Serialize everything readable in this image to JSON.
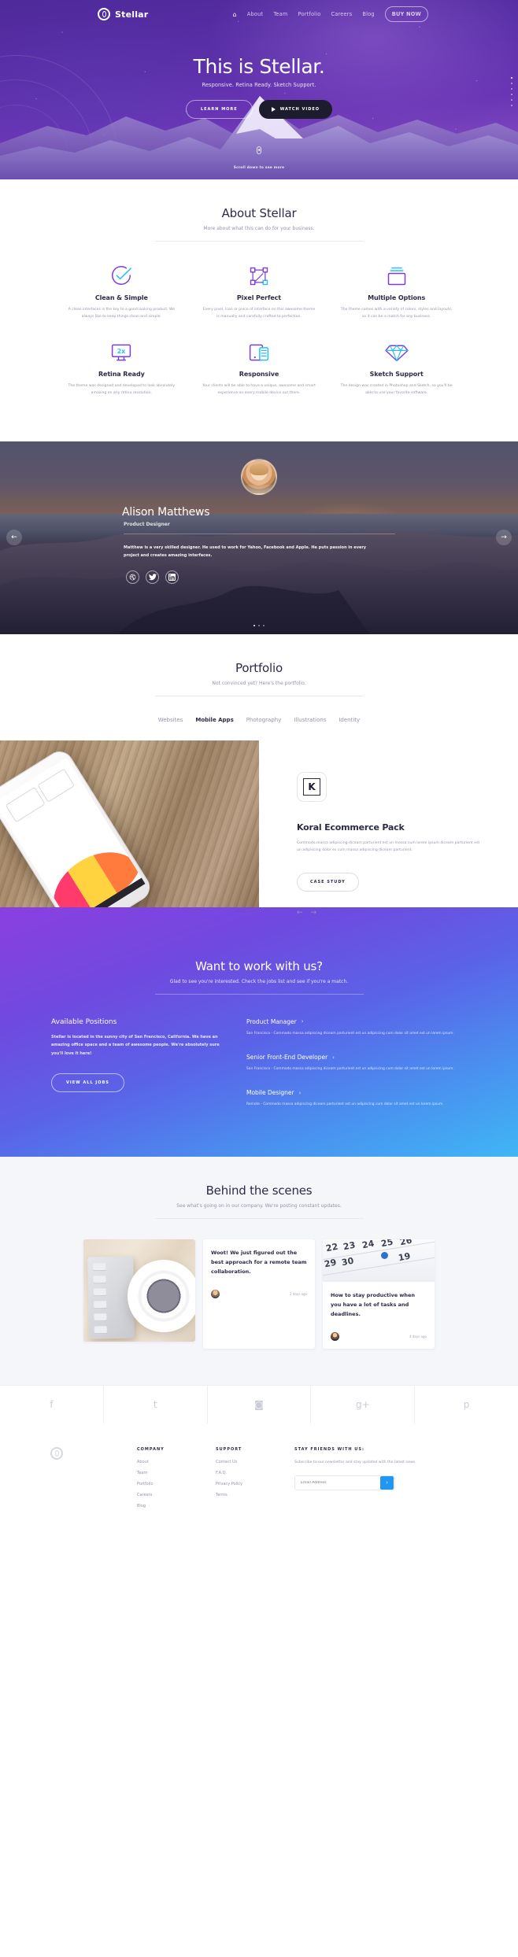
{
  "nav": {
    "brand": "Stellar",
    "brand_icon": "stellar-ring-logo",
    "items": [
      {
        "label": "⌂",
        "name": "home",
        "active": true
      },
      {
        "label": "About",
        "name": "about",
        "active": false
      },
      {
        "label": "Team",
        "name": "team",
        "active": false
      },
      {
        "label": "Portfolio",
        "name": "portfolio",
        "active": false
      },
      {
        "label": "Careers",
        "name": "careers",
        "active": false
      },
      {
        "label": "Blog",
        "name": "blog",
        "active": false
      }
    ],
    "buy_now": "BUY NOW"
  },
  "hero": {
    "title": "This is Stellar.",
    "subtitle": "Responsive. Retina Ready. Sketch Support.",
    "btn_primary": "LEARN MORE",
    "btn_secondary": "WATCH VIDEO",
    "scroll_hint": "Scroll down to see more"
  },
  "about": {
    "title": "About Stellar",
    "subtitle": "More about what this can do for your business.",
    "features": [
      {
        "icon": "check-circle-icon",
        "title": "Clean & Simple",
        "desc": "A clean interfaces is the key to a good looking product. We always like to keep things clean and simple."
      },
      {
        "icon": "vector-nodes-icon",
        "title": "Pixel Perfect",
        "desc": "Every pixel, icon or piece of interface on this awesome theme is manually and carefully crafted to perfection."
      },
      {
        "icon": "layers-stack-icon",
        "title": "Multiple Options",
        "desc": "The theme comes with a variety of colors, styles and layouts, so it can be a match for any business."
      },
      {
        "icon": "retina-monitor-icon",
        "title": "Retina Ready",
        "desc": "The theme was designed and developed to look absolutely amazing on any retina resolution."
      },
      {
        "icon": "devices-responsive-icon",
        "title": "Responsive",
        "desc": "Your clients will be able to have a unique, awesome and smart experience on every mobile device out there."
      },
      {
        "icon": "diamond-sketch-icon",
        "title": "Sketch Support",
        "desc": "The design was created in Photoshop and Sketch, so you'll be able to use your favorite software."
      }
    ]
  },
  "testimonial": {
    "avatar": "alison-avatar",
    "name": "Alison Matthews",
    "role": "Product Designer",
    "quote": "Matthew is a very skilled designer. He used to work for Yahoo, Facebook and Apple. He puts passion in every project and creates amazing interfaces.",
    "socials": [
      "dribbble-icon",
      "twitter-icon",
      "linkedin-icon"
    ],
    "prev": "←",
    "next": "→",
    "dots": 3,
    "active_dot": 0
  },
  "portfolio": {
    "title": "Portfolio",
    "subtitle": "Not convinced yet? Here's the portfolio.",
    "tabs": [
      {
        "label": "Websites",
        "active": false
      },
      {
        "label": "Mobile Apps",
        "active": true
      },
      {
        "label": "Photography",
        "active": false
      },
      {
        "label": "Illustrations",
        "active": false
      },
      {
        "label": "Identity",
        "active": false
      }
    ],
    "item": {
      "logo_letter": "K",
      "title": "Koral Ecommerce Pack",
      "desc": "Commodo massa adipiscing diceam parturient est un massa cum lorem ipsum diceam parturient est un adipiscing dolor es cum massa adipiscing diceam parturient.",
      "cta": "CASE STUDY",
      "prev": "←",
      "next": "→"
    }
  },
  "careers": {
    "title": "Want to work with us?",
    "subtitle": "Glad to see you're interested. Check the jobs list and see if you're a match.",
    "left_heading": "Available Positions",
    "left_desc": "Stellar is located in the sunny city of San Francisco, California. We have an amazing office space and a team of awesome people. We're absolutely sure you'll love it here!",
    "left_cta": "VIEW ALL JOBS",
    "jobs": [
      {
        "title": "Product Manager",
        "chevron": "›",
        "desc": "San Francisco - Commodo massa adipiscing diceam parturient est un adipiscing cum dolor sit amet est un lorem ipsum."
      },
      {
        "title": "Senior Front-End Developer",
        "chevron": "›",
        "desc": "San Francisco - Commodo massa adipiscing diceam parturient est un adipiscing cum dolor sit amet est un lorem ipsum."
      },
      {
        "title": "Mobile Designer",
        "chevron": "›",
        "desc": "Remote - Commodo massa adipiscing diceam parturient est un adipiscing cum dolor sit amet est un lorem ipsum."
      }
    ]
  },
  "blog": {
    "title": "Behind the scenes",
    "subtitle": "See what's going on in our company. We're posting constant updates.",
    "posts": [
      {
        "type": "image",
        "image": "keyboard-and-coffee-photo"
      },
      {
        "type": "text",
        "title": "Woot! We just figured out the best approach for a remote team collaboration.",
        "author_avatar": "author-avatar-male",
        "time": "2 days ago"
      },
      {
        "type": "text",
        "image": "calendar-photo",
        "title": "How to stay productive when you have a lot of tasks and deadlines.",
        "author_avatar": "author-avatar-female",
        "time": "4 days ago"
      }
    ]
  },
  "social_bar": [
    {
      "icon": "facebook-icon",
      "glyph": "f"
    },
    {
      "icon": "twitter-icon",
      "glyph": "t"
    },
    {
      "icon": "instagram-icon",
      "glyph": "◙"
    },
    {
      "icon": "google-plus-icon",
      "glyph": "g+"
    },
    {
      "icon": "pinterest-icon",
      "glyph": "p"
    }
  ],
  "footer": {
    "logo_icon": "stellar-ring-logo-grey",
    "columns": [
      {
        "heading": "COMPANY",
        "links": [
          "About",
          "Team",
          "Portfolio",
          "Careers",
          "Blog"
        ]
      },
      {
        "heading": "SUPPORT",
        "links": [
          "Contact Us",
          "F.A.Q.",
          "Privacy Policy",
          "Terms"
        ]
      }
    ],
    "newsletter": {
      "heading": "STAY FRIENDS WITH US:",
      "desc": "Subscribe to our newsletter and stay updated with the latest news.",
      "placeholder": "Email Address",
      "value": "",
      "submit": "›",
      "accent": "#2196f3"
    }
  }
}
